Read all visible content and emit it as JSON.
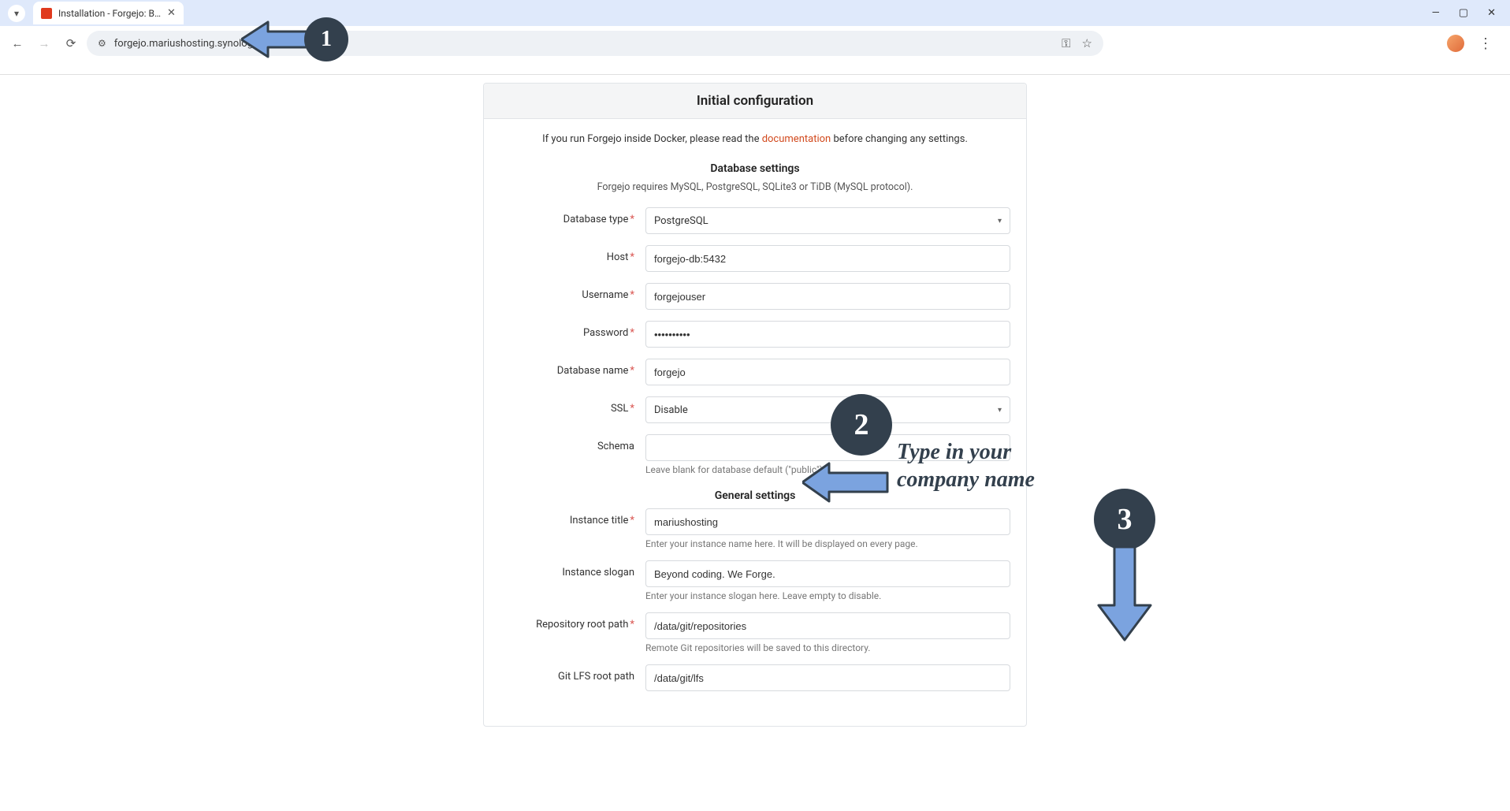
{
  "browser": {
    "tab_title": "Installation - Forgejo: Beyond c",
    "url": "forgejo.mariushosting.synology.me"
  },
  "panel": {
    "header": "Initial configuration",
    "intro_pre": "If you run Forgejo inside Docker, please read the ",
    "intro_link": "documentation",
    "intro_post": " before changing any settings."
  },
  "db": {
    "section_title": "Database settings",
    "section_sub": "Forgejo requires MySQL, PostgreSQL, SQLite3 or TiDB (MySQL protocol).",
    "type_label": "Database type",
    "type_value": "PostgreSQL",
    "host_label": "Host",
    "host_value": "forgejo-db:5432",
    "user_label": "Username",
    "user_value": "forgejouser",
    "pass_label": "Password",
    "pass_value": "••••••••••",
    "name_label": "Database name",
    "name_value": "forgejo",
    "ssl_label": "SSL",
    "ssl_value": "Disable",
    "schema_label": "Schema",
    "schema_value": "",
    "schema_help": "Leave blank for database default (\"public\")."
  },
  "general": {
    "section_title": "General settings",
    "title_label": "Instance title",
    "title_value": "mariushosting",
    "title_help": "Enter your instance name here. It will be displayed on every page.",
    "slogan_label": "Instance slogan",
    "slogan_value": "Beyond coding. We Forge.",
    "slogan_help": "Enter your instance slogan here. Leave empty to disable.",
    "repo_label": "Repository root path",
    "repo_value": "/data/git/repositories",
    "repo_help": "Remote Git repositories will be saved to this directory.",
    "lfs_label": "Git LFS root path",
    "lfs_value": "/data/git/lfs"
  },
  "annotations": {
    "n1": "1",
    "n2": "2",
    "n3": "3",
    "text2": "Type in your\ncompany name"
  },
  "colors": {
    "arrow_fill": "#7ba3df",
    "arrow_stroke": "#33404d",
    "badge_bg": "#33404d"
  }
}
